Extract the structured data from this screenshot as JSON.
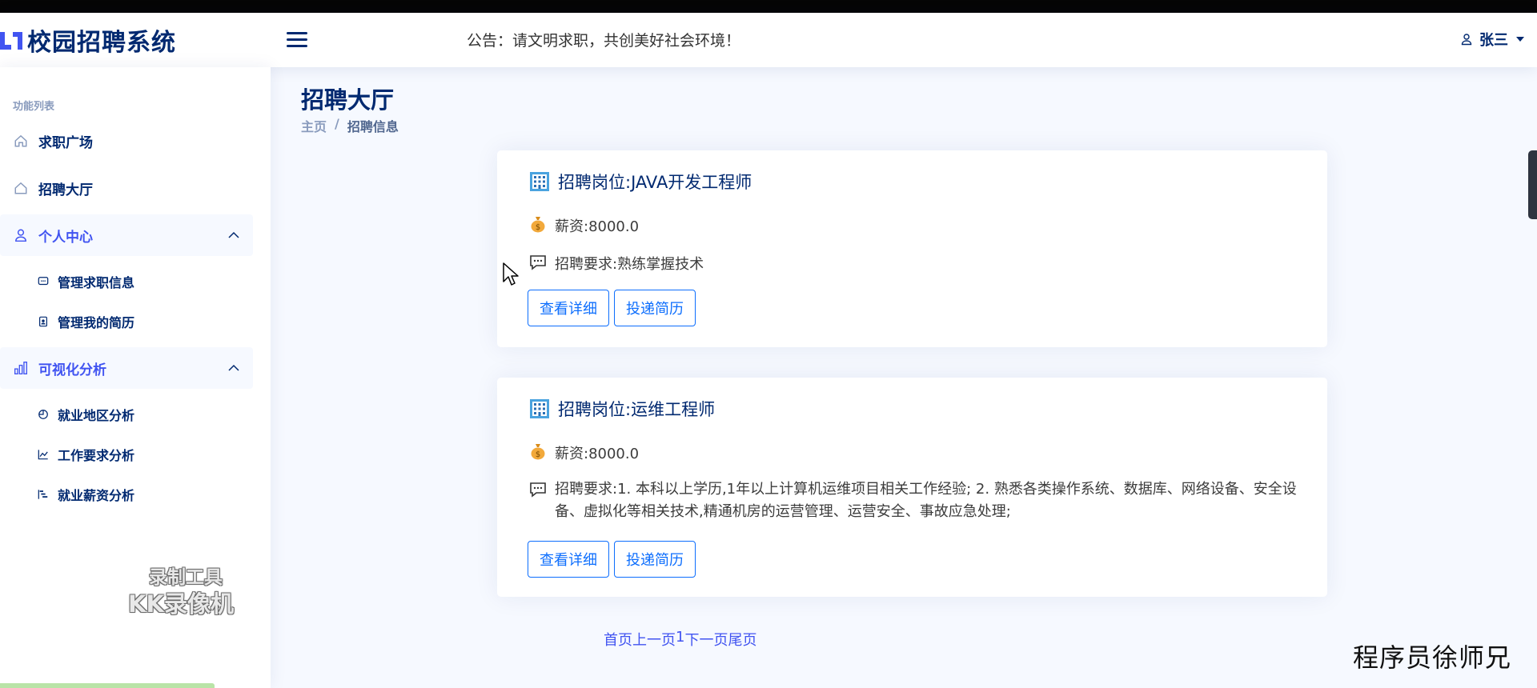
{
  "header": {
    "logo_text": "校园招聘系统",
    "notice": "公告：请文明求职，共创美好社会环境！",
    "user_name": "张三"
  },
  "sidebar": {
    "heading": "功能列表",
    "items": [
      {
        "label": "求职广场",
        "icon": "home-icon"
      },
      {
        "label": "招聘大厅",
        "icon": "home-icon"
      },
      {
        "label": "个人中心",
        "icon": "person-icon",
        "expanded": true,
        "children": [
          {
            "label": "管理求职信息",
            "icon": "chat-square-icon"
          },
          {
            "label": "管理我的简历",
            "icon": "file-person-icon"
          }
        ]
      },
      {
        "label": "可视化分析",
        "icon": "bar-chart-icon",
        "expanded": true,
        "children": [
          {
            "label": "就业地区分析",
            "icon": "pie-chart-icon"
          },
          {
            "label": "工作要求分析",
            "icon": "graph-icon"
          },
          {
            "label": "就业薪资分析",
            "icon": "bar-chart-steps-icon"
          }
        ]
      }
    ],
    "watermark_line1": "录制工具",
    "watermark_line2": "KK录像机"
  },
  "page": {
    "title": "招聘大厅",
    "breadcrumb": [
      "主页",
      "/",
      "招聘信息"
    ]
  },
  "jobs": [
    {
      "title": "招聘岗位:JAVA开发工程师",
      "salary": "薪资:8000.0",
      "requirement": "招聘要求:熟练掌握技术",
      "detail_label": "查看详细",
      "apply_label": "投递简历"
    },
    {
      "title": "招聘岗位:运维工程师",
      "salary": "薪资:8000.0",
      "requirement": "招聘要求:1. 本科以上学历,1年以上计算机运维项目相关工作经验; 2. 熟悉各类操作系统、数据库、网络设备、安全设备、虚拟化等相关技术,精通机房的运营管理、运营安全、事故应急处理;",
      "detail_label": "查看详细",
      "apply_label": "投递简历"
    }
  ],
  "pager": {
    "first": "首页",
    "prev": "上一页",
    "current": "1",
    "next": "下一页",
    "last": "尾页"
  },
  "watermark_corner": "程序员徐师兄",
  "colors": {
    "primary": "#4154f1",
    "navy": "#012970",
    "button": "#0d6efd",
    "background": "#f6f9ff"
  }
}
